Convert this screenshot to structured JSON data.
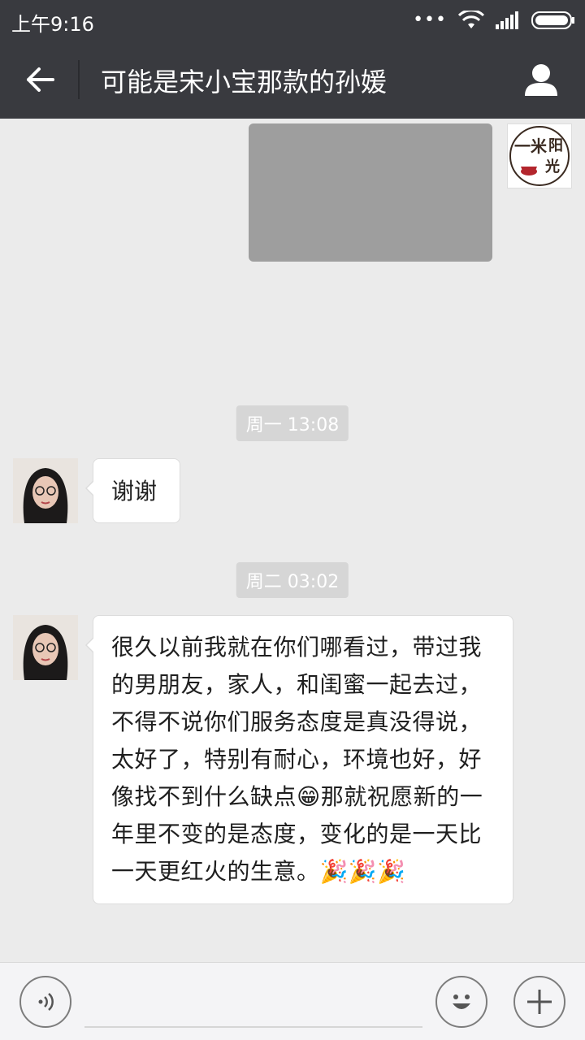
{
  "status_bar": {
    "time": "上午9:16",
    "dots": "•••"
  },
  "header": {
    "title": "可能是宋小宝那款的孙媛"
  },
  "messages": {
    "timestamp_1": "周一 13:08",
    "text_1": "谢谢",
    "timestamp_2": "周二 03:02",
    "text_2": "很久以前我就在你们哪看过，带过我的男朋友，家人，和闺蜜一起去过，不得不说你们服务态度是真没得说，太好了，特别有耐心，环境也好，好像找不到什么缺点😁那就祝愿新的一年里不变的是态度，变化的是一天比一天更红火的生意。🎉🎉🎉"
  },
  "logo": {
    "text_1": "一米",
    "text_2": "阳",
    "text_3": "光"
  },
  "input": {
    "value": ""
  },
  "colors": {
    "header_bg": "#393a3f",
    "chat_bg": "#ebebeb",
    "logo_red": "#b3262d"
  },
  "icons": [
    "back-arrow-icon",
    "profile-icon",
    "wifi-icon",
    "signal-icon",
    "battery-icon",
    "voice-icon",
    "emoji-icon",
    "plus-icon"
  ]
}
